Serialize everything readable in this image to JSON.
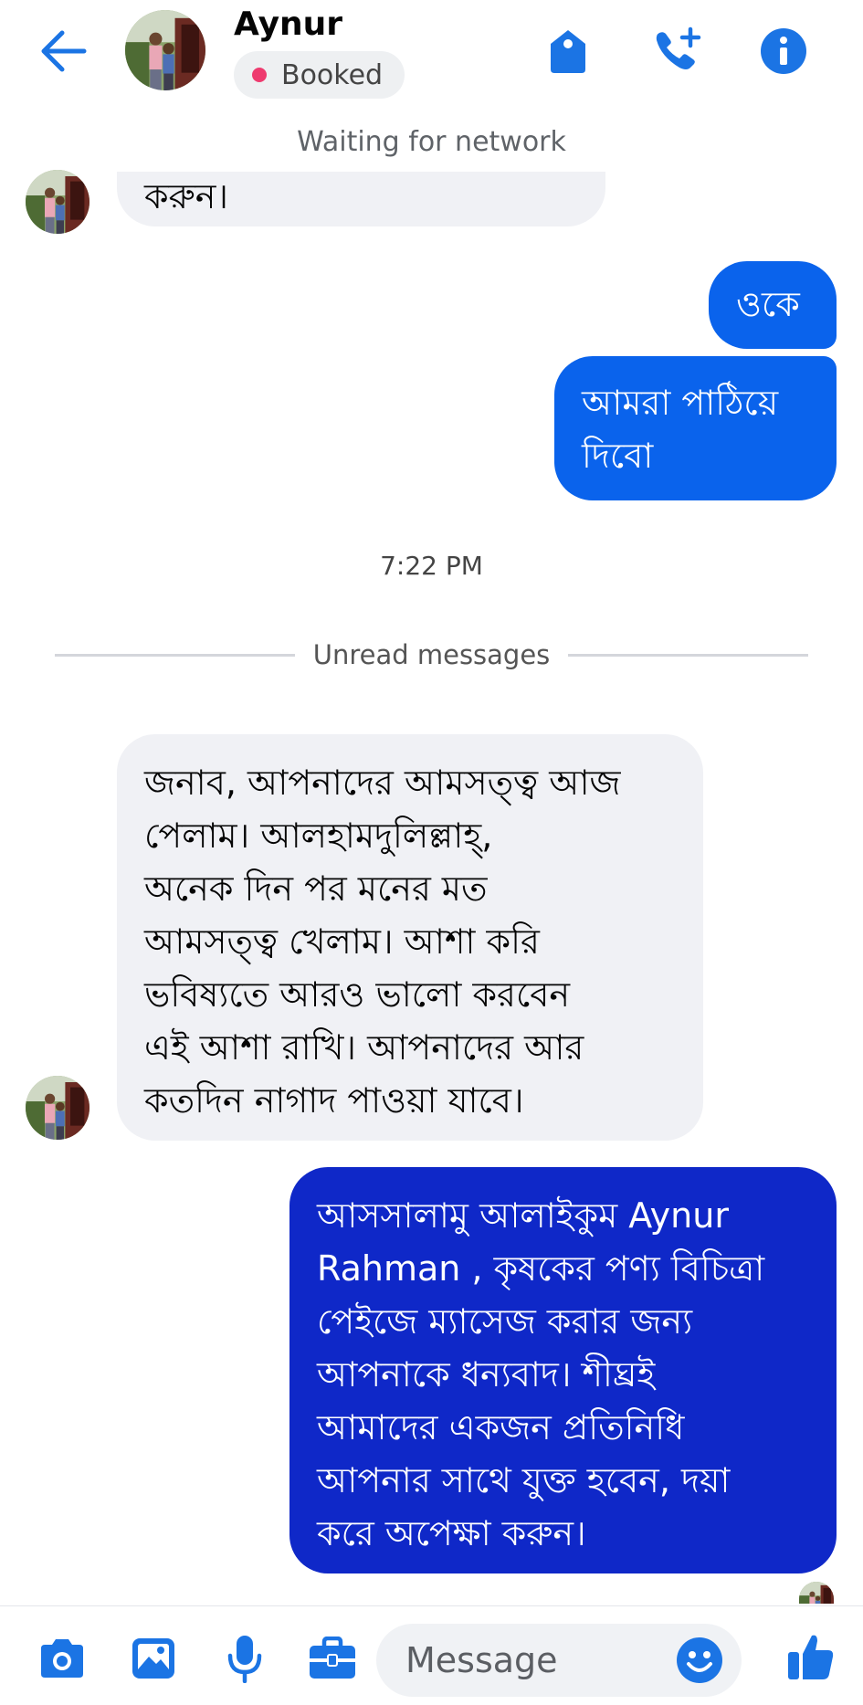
{
  "header": {
    "contact_name": "Aynur",
    "label_chip": "Booked",
    "back_icon": "arrow-left-icon",
    "icons": [
      "tag-icon",
      "add-call-icon",
      "info-icon"
    ],
    "accent": "#1b74e4"
  },
  "status": "Waiting for network",
  "messages": {
    "m1_tail": "করুন।",
    "m2": "ওকে",
    "m3": [
      "আমরা পাঠিয়ে",
      "দিবো"
    ],
    "timestamp": "7:22 PM",
    "unread_divider": "Unread messages",
    "m4": [
      "জনাব,  আপনাদের আমসত্ত্ব আজ",
      "পেলাম।  আলহামদুলিল্লাহ্‌,",
      "অনেক দিন পর মনের মত",
      "আমসত্ত্ব খেলাম।  আশা করি",
      "ভবিষ্যতে আরও ভালো করবেন",
      "এই আশা রাখি।  আপনাদের আর",
      "কতদিন নাগাদ পাওয়া যাবে।"
    ],
    "m5": [
      "আসসালামু আলাইকুম Aynur",
      "Rahman , কৃষকের পণ্য বিচিত্রা",
      "পেইজে ম্যাসেজ করার জন্য",
      "আপনাকে ধন্যবাদ। শীঘ্রই",
      "আমাদের একজন প্রতিনিধি",
      "আপনার সাথে যুক্ত হবেন, দয়া",
      "করে অপেক্ষা করুন।"
    ]
  },
  "composer": {
    "placeholder": "Message",
    "icons": [
      "camera-icon",
      "gallery-icon",
      "microphone-icon",
      "briefcase-icon",
      "emoji-icon",
      "thumbs-up-icon"
    ]
  },
  "colors": {
    "outgoing_bubble": "#0a63ec",
    "outgoing_bubble_dark": "#0f28c8",
    "incoming_bubble": "#f0f1f5",
    "label_dot": "#ee3b6f"
  }
}
